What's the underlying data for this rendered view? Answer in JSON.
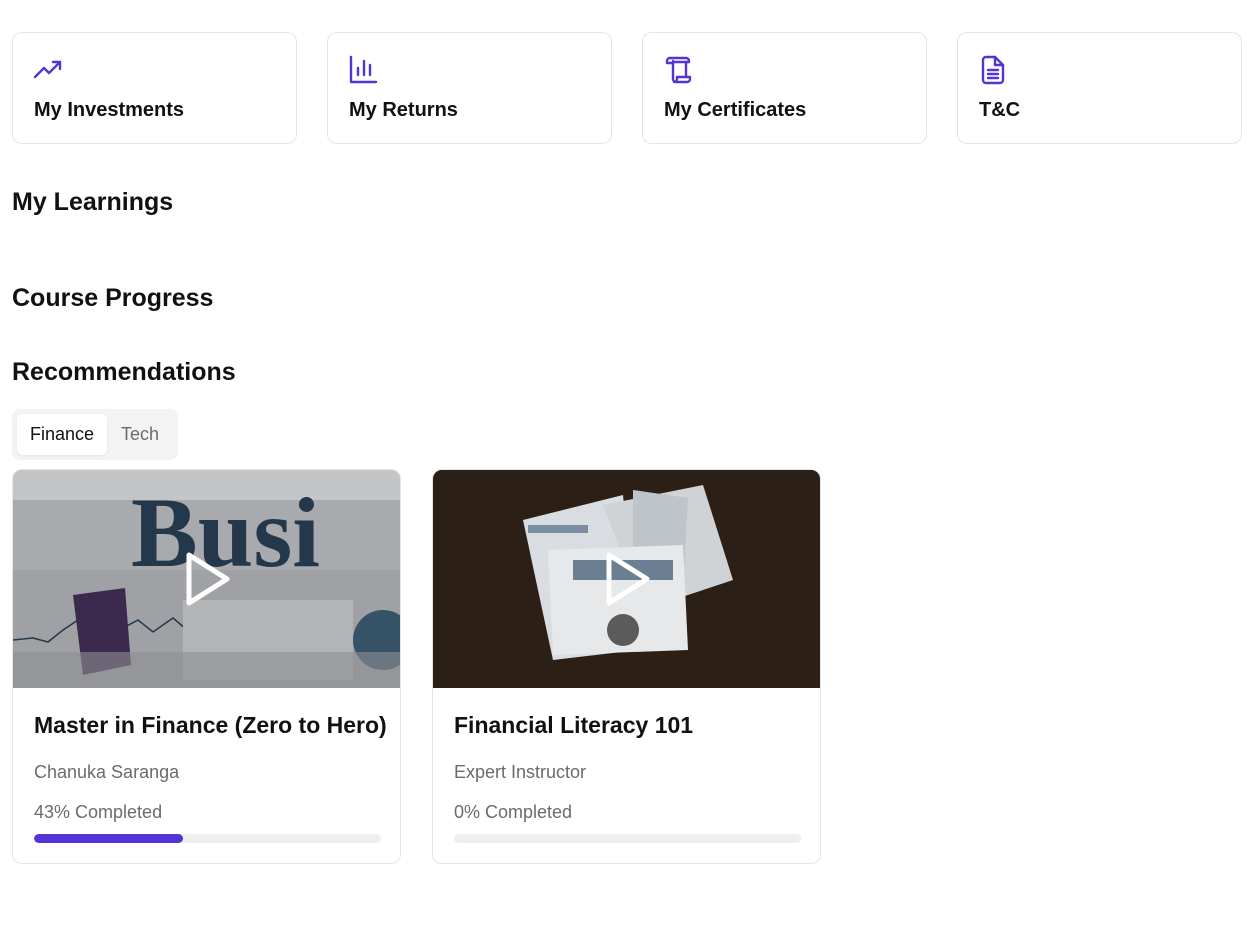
{
  "accent_color": "#5434d4",
  "quick_links": [
    {
      "label": "My Investments",
      "icon": "trending-up-icon"
    },
    {
      "label": "My Returns",
      "icon": "bar-chart-icon"
    },
    {
      "label": "My Certificates",
      "icon": "scroll-icon"
    },
    {
      "label": "T&C",
      "icon": "document-icon"
    }
  ],
  "sections": {
    "learnings": "My Learnings",
    "progress": "Course Progress",
    "recommendations": "Recommendations"
  },
  "tabs": [
    {
      "label": "Finance",
      "active": true
    },
    {
      "label": "Tech",
      "active": false
    }
  ],
  "courses": [
    {
      "title": "Master in Finance (Zero to Hero)",
      "instructor": "Chanuka Saranga",
      "progress_text": "43% Completed",
      "progress": 0.43,
      "thumbnail": "newspaper-business-photo"
    },
    {
      "title": "Financial Literacy 101",
      "instructor": "Expert Instructor",
      "progress_text": "0% Completed",
      "progress": 0.0,
      "thumbnail": "newspapers-on-wood-photo"
    }
  ]
}
